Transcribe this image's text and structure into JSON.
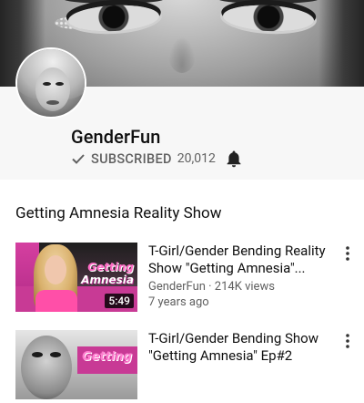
{
  "channel": {
    "name": "GenderFun",
    "subscribed_label": "SUBSCRIBED",
    "subscriber_count": "20,012"
  },
  "section": {
    "title": "Getting Amnesia Reality Show"
  },
  "videos": [
    {
      "title": "T-Girl/Gender Bending Reality Show \"Getting Amnesia\"...",
      "title_lines": [
        "T-Girl/Gender Bending Reality",
        "Show \"Getting Amnesia\"..."
      ],
      "channel": "GenderFun",
      "views": "214K views",
      "channel_views": "GenderFun · 214K views",
      "age": "7 years ago",
      "duration": "5:49",
      "thumb_text": [
        "Getting",
        "Amnesia"
      ]
    },
    {
      "title": "T-Girl/Gender Bending Show \"Getting Amnesia\" Ep#2",
      "title_lines": [
        "T-Girl/Gender Bending Show",
        "\"Getting Amnesia\" Ep#2"
      ],
      "thumb_text": [
        "Getting"
      ]
    }
  ],
  "icons": {
    "check": "check-icon",
    "bell": "bell-icon",
    "more": "more-vert-icon"
  },
  "colors": {
    "secondary_text": "#606060",
    "primary_text": "#0f0f0f",
    "thumb_pink": "#c83a95"
  }
}
